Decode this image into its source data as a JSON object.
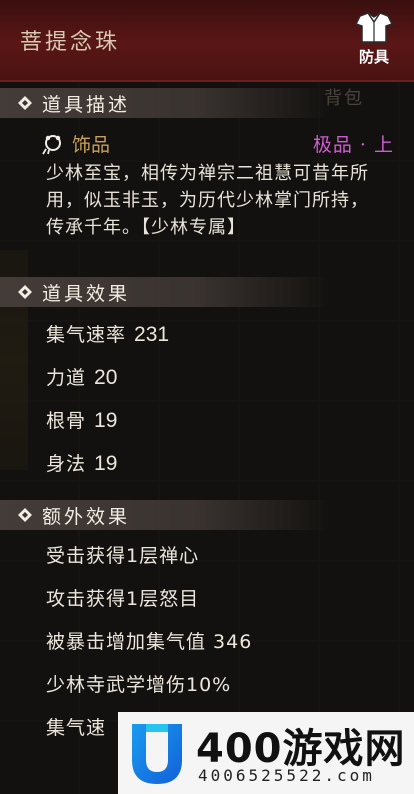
{
  "header": {
    "title": "菩提念珠",
    "category_badge": "防具",
    "category_icon": "armor-icon",
    "bag_label": "背包"
  },
  "sections": {
    "description_title": "道具描述",
    "effects_title": "道具效果",
    "extra_title": "额外效果"
  },
  "item": {
    "type_icon": "bead-icon",
    "type": "饰品",
    "grade": "极品 · 上",
    "description": "少林至宝，相传为禅宗二祖慧可昔年所用，似玉非玉，为历代少林掌门所持，传承千年。【少林专属】"
  },
  "stats": [
    {
      "name": "集气速率",
      "value": "231"
    },
    {
      "name": "力道",
      "value": "20"
    },
    {
      "name": "根骨",
      "value": "19"
    },
    {
      "name": "身法",
      "value": "19"
    }
  ],
  "extra_effects": [
    "受击获得1层禅心",
    "攻击获得1层怒目",
    "被暴击增加集气值 346",
    "少林寺武学增伤10%",
    "集气速"
  ],
  "watermark": {
    "brand": "400游戏网",
    "phone": "4006525522.com"
  },
  "colors": {
    "title_bar": "#5a1616",
    "grade": "#d05cd2",
    "item_type": "#c9a15a",
    "text": "#e8e2d8"
  }
}
